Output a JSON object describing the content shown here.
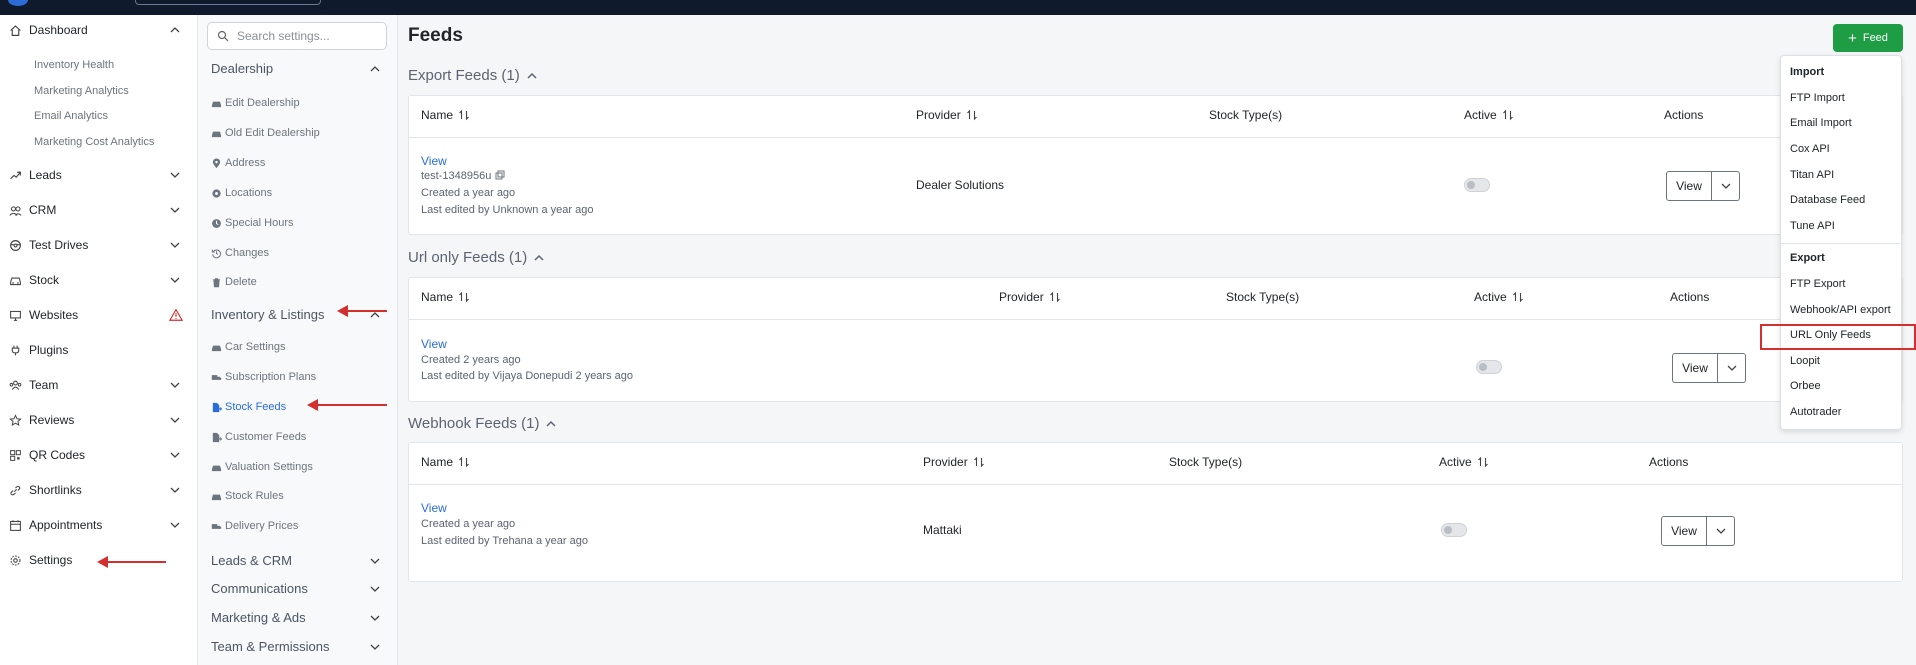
{
  "leftnav": {
    "dashboard": "Dashboard",
    "dashboard_sub": [
      "Inventory Health",
      "Marketing Analytics",
      "Email Analytics",
      "Marketing Cost Analytics"
    ],
    "items": [
      "Leads",
      "CRM",
      "Test Drives",
      "Stock",
      "Websites",
      "Plugins",
      "Team",
      "Reviews",
      "QR Codes",
      "Shortlinks",
      "Appointments",
      "Settings"
    ],
    "icons": [
      "home-icon",
      "leads-icon",
      "crm-icon",
      "steering-icon",
      "car-icon",
      "monitor-icon",
      "plug-icon",
      "team-icon",
      "star-icon",
      "qr-icon",
      "link-icon",
      "calendar-icon",
      "gear-icon"
    ]
  },
  "settings_panel": {
    "search_placeholder": "Search settings...",
    "dealership": {
      "title": "Dealership",
      "items": [
        "Edit Dealership",
        "Old Edit Dealership",
        "Address",
        "Locations",
        "Special Hours",
        "Changes",
        "Delete"
      ]
    },
    "inventory": {
      "title": "Inventory & Listings",
      "items": [
        "Car Settings",
        "Subscription Plans",
        "Stock Feeds",
        "Customer Feeds",
        "Valuation Settings",
        "Stock Rules",
        "Delivery Prices"
      ],
      "active": "Stock Feeds"
    },
    "collapsed": [
      "Leads & CRM",
      "Communications",
      "Marketing & Ads",
      "Team & Permissions"
    ]
  },
  "main": {
    "title": "Feeds",
    "add_button": "Feed",
    "sections": [
      {
        "title": "Export Feeds (1)",
        "columns": [
          "Name",
          "Provider",
          "Stock Type(s)",
          "Active",
          "Actions"
        ],
        "row": {
          "link": "View",
          "id": "test-1348956u",
          "created": "Created a year ago",
          "edited": "Last edited by Unknown a year ago",
          "provider": "Dealer Solutions",
          "action": "View"
        }
      },
      {
        "title": "Url only Feeds (1)",
        "columns": [
          "Name",
          "Provider",
          "Stock Type(s)",
          "Active",
          "Actions"
        ],
        "row": {
          "link": "View",
          "created": "Created 2 years ago",
          "edited": "Last edited by Vijaya Donepudi 2 years ago",
          "provider": "",
          "action": "View"
        }
      },
      {
        "title": "Webhook Feeds (1)",
        "columns": [
          "Name",
          "Provider",
          "Stock Type(s)",
          "Active",
          "Actions"
        ],
        "row": {
          "link": "View",
          "created": "Created a year ago",
          "edited": "Last edited by Trehana a year ago",
          "provider": "Mattaki",
          "action": "View"
        }
      }
    ]
  },
  "dropdown": {
    "import_header": "Import",
    "import_items": [
      "FTP Import",
      "Email Import",
      "Cox API",
      "Titan API",
      "Database Feed",
      "Tune API"
    ],
    "export_header": "Export",
    "export_items": [
      "FTP Export",
      "Webhook/API export",
      "URL Only Feeds",
      "Loopit",
      "Orbee",
      "Autotrader"
    ]
  },
  "colors": {
    "accent": "#2a6dd9",
    "success": "#1f9d45",
    "annotation": "#d32f2f",
    "topbar": "#0f1b2d"
  }
}
